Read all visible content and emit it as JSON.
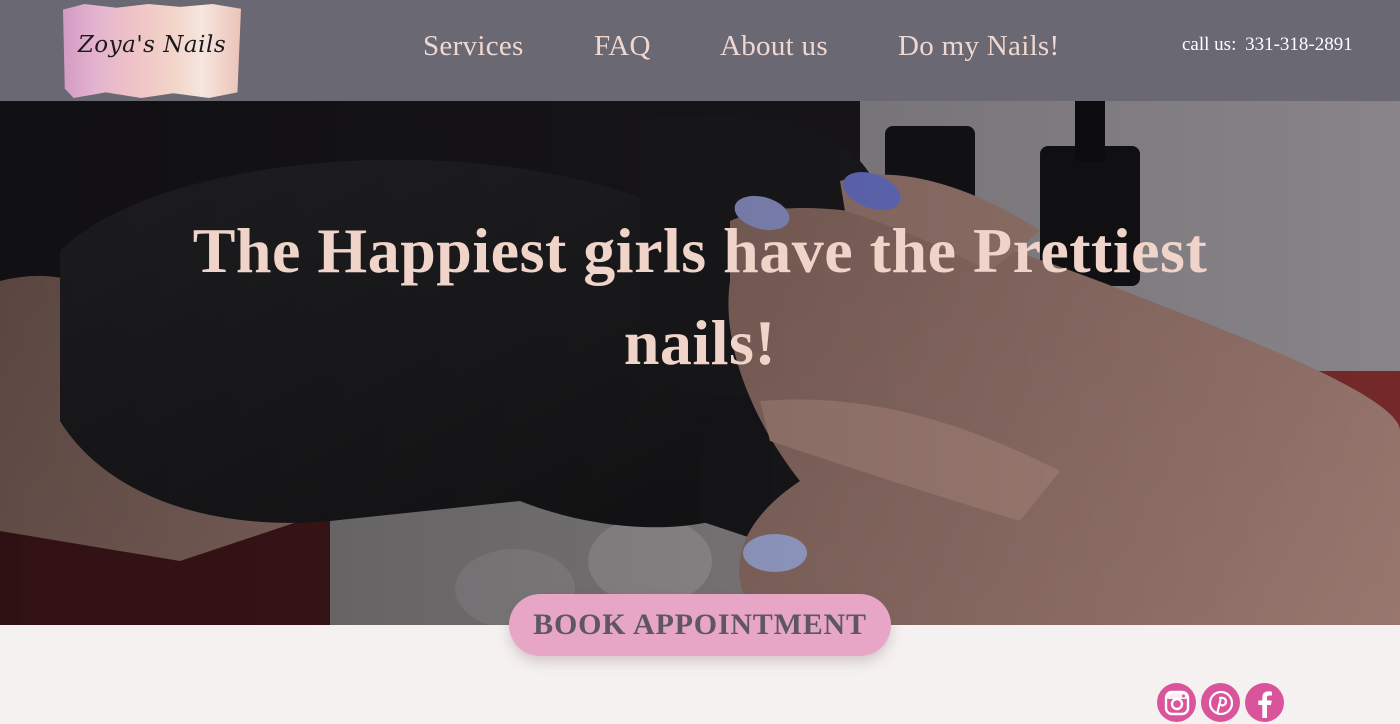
{
  "brand": {
    "logo_text": "Zoya's Nails"
  },
  "nav": {
    "items": [
      {
        "label": "Services"
      },
      {
        "label": "FAQ"
      },
      {
        "label": "About us"
      },
      {
        "label": "Do my Nails!"
      }
    ]
  },
  "contact": {
    "phone_label": "call us:",
    "phone_number": "331-318-2891"
  },
  "hero": {
    "headline_line1": "The Happiest girls have the Prettiest",
    "headline_line2": "nails!"
  },
  "cta": {
    "book_label": "BOOK APPOINTMENT"
  },
  "social": {
    "icons": [
      "instagram-icon",
      "pinterest-icon",
      "facebook-icon"
    ]
  },
  "colors": {
    "header_bg": "#696873",
    "nav_text": "#f0d7cf",
    "headline_text": "#f0d3c9",
    "cta_bg": "#e8a6c6",
    "cta_text": "#5e5763",
    "social_bg": "#d9549a",
    "page_bg": "#f5f1f0"
  }
}
